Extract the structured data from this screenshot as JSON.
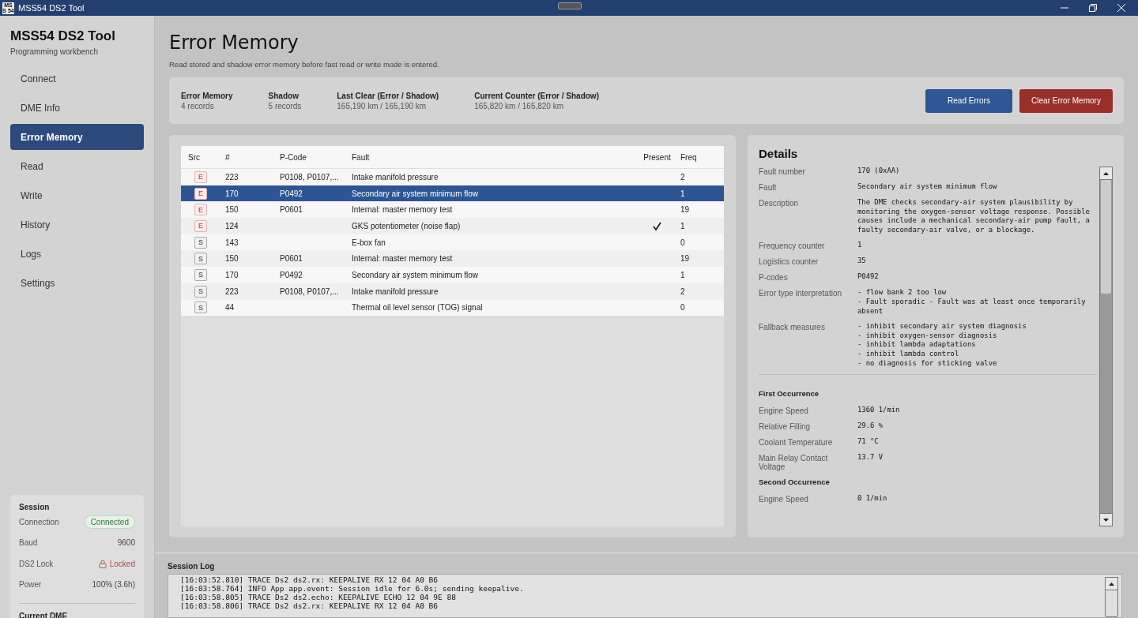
{
  "window": {
    "title": "MSS54 DS2 Tool",
    "icon_text": "MSS 54"
  },
  "sidebar": {
    "app_title": "MSS54 DS2 Tool",
    "subtitle": "Programming workbench",
    "nav": [
      {
        "label": "Connect",
        "selected": false
      },
      {
        "label": "DME Info",
        "selected": false
      },
      {
        "label": "Error Memory",
        "selected": true
      },
      {
        "label": "Read",
        "selected": false
      },
      {
        "label": "Write",
        "selected": false
      },
      {
        "label": "History",
        "selected": false
      },
      {
        "label": "Logs",
        "selected": false
      },
      {
        "label": "Settings",
        "selected": false
      }
    ],
    "session": {
      "heading": "Session",
      "rows": [
        {
          "label": "Connection",
          "value": "Connected",
          "kind": "status"
        },
        {
          "label": "Baud",
          "value": "9600",
          "kind": "plain"
        },
        {
          "label": "DS2 Lock",
          "value": "Locked",
          "kind": "lock"
        },
        {
          "label": "Power",
          "value": "100% (3.6h)",
          "kind": "plain"
        }
      ]
    },
    "current_dme": {
      "heading": "Current DME"
    }
  },
  "page": {
    "title": "Error Memory",
    "subtitle": "Read stored and shadow error memory before fast read or write mode is entered."
  },
  "summary": [
    {
      "label": "Error Memory",
      "value": "4 records"
    },
    {
      "label": "Shadow",
      "value": "5 records"
    },
    {
      "label": "Last Clear (Error / Shadow)",
      "value": "165,190 km / 165,190 km"
    },
    {
      "label": "Current Counter (Error / Shadow)",
      "value": "165,820 km / 165,820 km"
    }
  ],
  "buttons": [
    {
      "label": "Read Errors",
      "kind": "primary"
    },
    {
      "label": "Clear Error Memory",
      "kind": "danger"
    }
  ],
  "table": {
    "columns": [
      "Src",
      "#",
      "P-Code",
      "Fault",
      "Present",
      "Freq"
    ],
    "rows": [
      {
        "src": "E",
        "kind": "error",
        "number": "223",
        "pcode": "P0108, P0107,...",
        "fault": "Intake manifold pressure",
        "present": false,
        "freq": "2",
        "selected": false
      },
      {
        "src": "E",
        "kind": "error",
        "number": "170",
        "pcode": "P0492",
        "fault": "Secondary air system minimum flow",
        "present": false,
        "freq": "1",
        "selected": true
      },
      {
        "src": "E",
        "kind": "error",
        "number": "150",
        "pcode": "P0601",
        "fault": "Internal: master memory test",
        "present": false,
        "freq": "19",
        "selected": false
      },
      {
        "src": "E",
        "kind": "error",
        "number": "124",
        "pcode": "",
        "fault": "GKS potentiometer (noise flap)",
        "present": true,
        "freq": "1",
        "selected": false
      },
      {
        "src": "S",
        "kind": "shadow",
        "number": "143",
        "pcode": "",
        "fault": "E-box fan",
        "present": false,
        "freq": "0",
        "selected": false
      },
      {
        "src": "S",
        "kind": "shadow",
        "number": "150",
        "pcode": "P0601",
        "fault": "Internal: master memory test",
        "present": false,
        "freq": "19",
        "selected": false
      },
      {
        "src": "S",
        "kind": "shadow",
        "number": "170",
        "pcode": "P0492",
        "fault": "Secondary air system minimum flow",
        "present": false,
        "freq": "1",
        "selected": false
      },
      {
        "src": "S",
        "kind": "shadow",
        "number": "223",
        "pcode": "P0108, P0107,...",
        "fault": "Intake manifold pressure",
        "present": false,
        "freq": "2",
        "selected": false
      },
      {
        "src": "S",
        "kind": "shadow",
        "number": "44",
        "pcode": "",
        "fault": "Thermal oil level sensor (TOG) signal",
        "present": false,
        "freq": "0",
        "selected": false
      }
    ]
  },
  "details": {
    "title": "Details",
    "fields": [
      {
        "label": "Fault number",
        "value": "170 (0xAA)"
      },
      {
        "label": "Fault",
        "value": "Secondary air system minimum flow"
      },
      {
        "label": "Description",
        "value": "The DME checks secondary-air system plausibility by monitoring the oxygen-sensor voltage response. Possible causes include a mechanical secondary-air pump fault, a faulty secondary-air valve, or a blockage."
      },
      {
        "label": "Frequency counter",
        "value": "1"
      },
      {
        "label": "Logistics counter",
        "value": "35"
      },
      {
        "label": "P-codes",
        "value": "P0492"
      },
      {
        "label": "Error type interpretation",
        "value": "- flow bank 2 too low\n- Fault sporadic - Fault was at least once temporarily absent"
      },
      {
        "label": "Fallback measures",
        "value": "- inhibit secondary air system diagnosis\n- inhibit oxygen-sensor diagnosis\n- inhibit lambda adaptations\n- inhibit lambda control\n- no diagnosis for sticking valve"
      }
    ],
    "sections": [
      {
        "heading": "First Occurrence",
        "fields": [
          {
            "label": "Engine Speed",
            "value": "1360 1/min"
          },
          {
            "label": "Relative Filling",
            "value": "29.6 %"
          },
          {
            "label": "Coolant Temperature",
            "value": "71 °C"
          },
          {
            "label": "Main Relay Contact Voltage",
            "value": "13.7 V"
          }
        ]
      },
      {
        "heading": "Second Occurrence",
        "fields": [
          {
            "label": "Engine Speed",
            "value": "0 1/min"
          }
        ]
      }
    ]
  },
  "log": {
    "title": "Session Log",
    "lines": [
      "[16:03:52.810] TRACE Ds2 ds2.rx: KEEPALIVE RX 12 04 A0 B6",
      "[16:03:58.764] INFO App app.event: Session idle for 6.0s; sending keepalive.",
      "[16:03:58.805] TRACE Ds2 ds2.echo: KEEPALIVE ECHO 12 04 9E 88",
      "[16:03:58.806] TRACE Ds2 ds2.rx: KEEPALIVE RX 12 04 A0 B6"
    ]
  }
}
